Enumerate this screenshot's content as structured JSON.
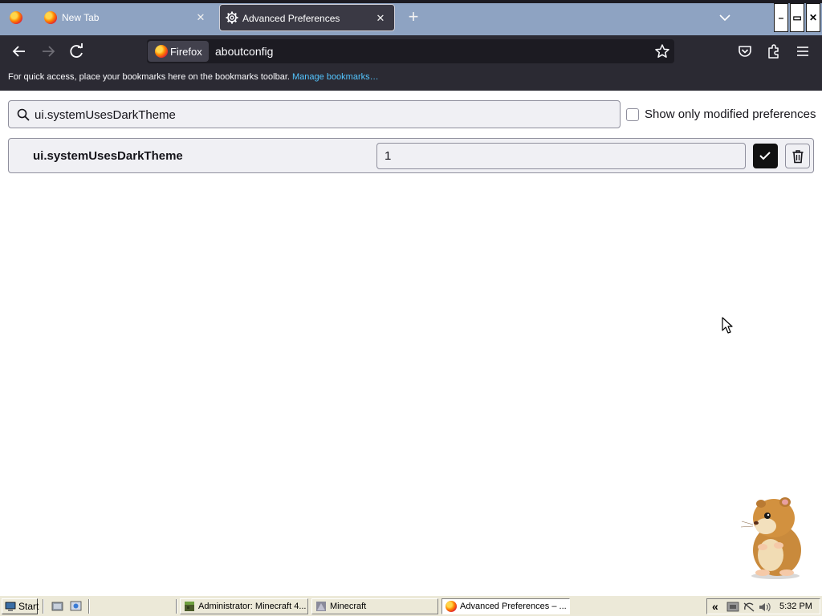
{
  "tabs": [
    {
      "label": "New Tab",
      "icon": "firefox-icon",
      "active": false
    },
    {
      "label": "Advanced Preferences",
      "icon": "gear-icon",
      "active": true
    }
  ],
  "window": {
    "minimize": "–",
    "restore": "▭",
    "close": "✕"
  },
  "toolbar": {
    "identity_label": "Firefox",
    "url": "aboutconfig"
  },
  "bookmarks_bar": {
    "message": "For quick access, place your bookmarks here on the bookmarks toolbar.",
    "link": "Manage bookmarks…"
  },
  "config": {
    "search_value": "ui.systemUsesDarkTheme",
    "show_modified_label": "Show only modified preferences",
    "show_modified_checked": false,
    "preference": {
      "name": "ui.systemUsesDarkTheme",
      "value": "1"
    }
  },
  "taskbar": {
    "start_label": "Start",
    "items": [
      {
        "label": "Administrator:  Minecraft 4...",
        "icon": "minecraft-block-icon"
      },
      {
        "label": "Minecraft",
        "icon": "minecraft-app-icon"
      },
      {
        "label": "Advanced Preferences – ...",
        "icon": "firefox-icon"
      }
    ],
    "clock": "5:32 PM"
  },
  "colors": {
    "tabstrip": "#8ea3c2",
    "toolbar": "#2b2a33",
    "link": "#54c5ff",
    "taskbar": "#ece9d8"
  }
}
